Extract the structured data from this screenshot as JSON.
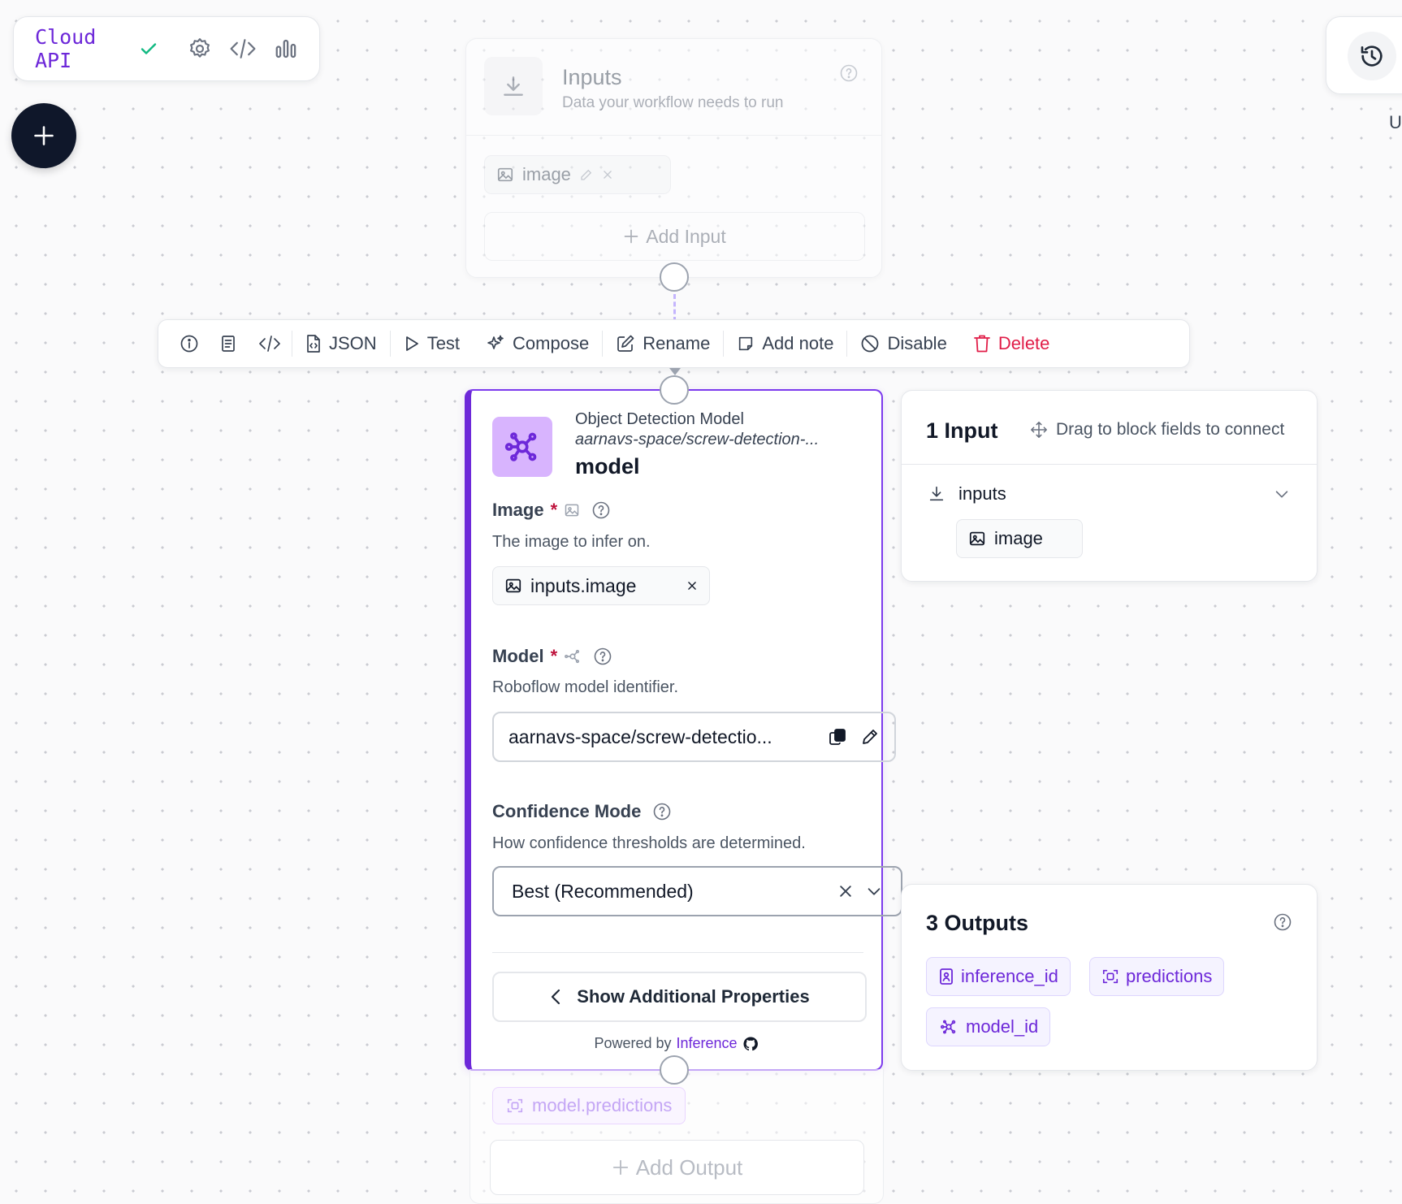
{
  "cloud": {
    "title": "Cloud API"
  },
  "inputs_block": {
    "title": "Inputs",
    "subtitle": "Data your workflow needs to run",
    "input_chip": "image",
    "add_input": "Add Input"
  },
  "toolbar": {
    "json": "JSON",
    "test": "Test",
    "compose": "Compose",
    "rename": "Rename",
    "add_note": "Add note",
    "disable": "Disable",
    "delete": "Delete"
  },
  "block": {
    "type": "Object Detection Model",
    "model_ref": "aarnavs-space/screw-detection-...",
    "name": "model",
    "image_field": {
      "label": "Image",
      "required_mark": "*",
      "description": "The image to infer on.",
      "value": "inputs.image"
    },
    "model_field": {
      "label": "Model",
      "required_mark": "*",
      "description": "Roboflow model identifier.",
      "value": "aarnavs-space/screw-detectio..."
    },
    "confidence_field": {
      "label": "Confidence Mode",
      "description": "How confidence thresholds are determined.",
      "value": "Best (Recommended)"
    },
    "show_more": "Show Additional Properties",
    "powered_by": "Powered by",
    "powered_link": "Inference"
  },
  "outputs_ghost": {
    "chip": "model.predictions",
    "add_output": "Add Output"
  },
  "input_panel": {
    "title": "1 Input",
    "hint": "Drag to block fields to connect",
    "group": "inputs",
    "chip": "image"
  },
  "output_panel": {
    "title": "3 Outputs",
    "chips": [
      "inference_id",
      "predictions",
      "model_id"
    ]
  },
  "right_edge_char": "U",
  "colors": {
    "accent": "#6d28d9",
    "accent_light": "#d8b4fe",
    "danger": "#e11d48",
    "success": "#10b981"
  }
}
